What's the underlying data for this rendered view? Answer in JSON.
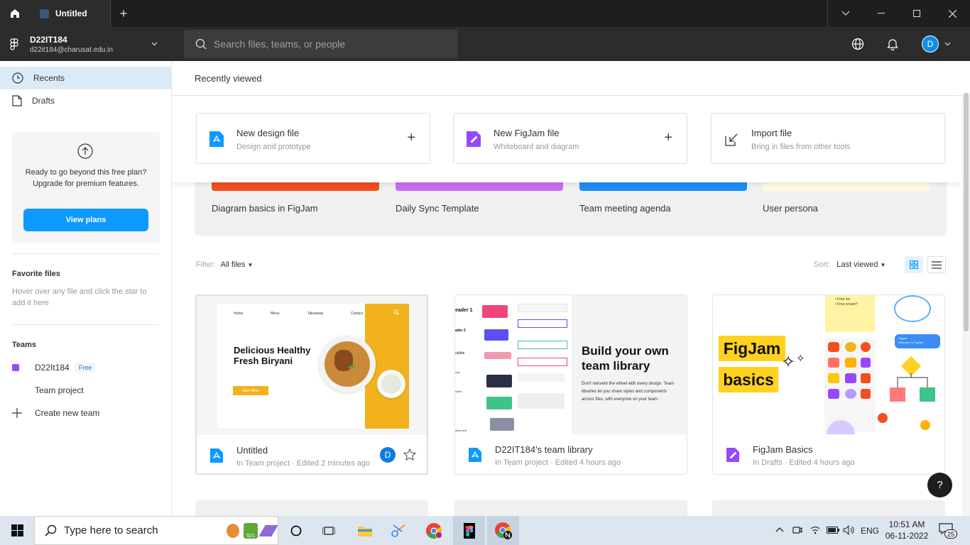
{
  "window": {
    "tab_title": "Untitled",
    "new_tab": "+"
  },
  "header": {
    "team_name": "D22IT184",
    "team_email": "d22it184@charusat.edu.in",
    "search_placeholder": "Search files, teams, or people",
    "avatar_letter": "D"
  },
  "sidebar": {
    "recents": "Recents",
    "drafts": "Drafts",
    "upgrade_text": "Ready to go beyond this free plan? Upgrade for premium features.",
    "view_plans": "View plans",
    "favorite_heading": "Favorite files",
    "favorite_hint": "Hover over any file and click the star to add it here",
    "teams_heading": "Teams",
    "team_item": "D22It184",
    "free_badge": "Free",
    "team_project": "Team project",
    "create_team": "Create new team"
  },
  "main": {
    "title": "Recently viewed",
    "create": [
      {
        "title": "New design file",
        "subtitle": "Design and prototype"
      },
      {
        "title": "New FigJam file",
        "subtitle": "Whiteboard and diagram"
      },
      {
        "title": "Import file",
        "subtitle": "Bring in files from other tools"
      }
    ],
    "templates": [
      {
        "label": "Diagram basics in FigJam",
        "color": "#f24e1e"
      },
      {
        "label": "Daily Sync Template",
        "color": "#c86ef3"
      },
      {
        "label": "Team meeting agenda",
        "color": "#1d8cf8"
      },
      {
        "label": "User persona",
        "color": "#fff1c2"
      }
    ],
    "filter_label": "Filter:",
    "filter_value": "All files",
    "sort_label": "Sort:",
    "sort_value": "Last viewed",
    "files": [
      {
        "name": "Untitled",
        "meta": "In Team project · Edited 2 minutes ago",
        "avatar": "D"
      },
      {
        "name": "D22IT184's team library",
        "meta": "In Team project · Edited 4 hours ago"
      },
      {
        "name": "FigJam Basics",
        "meta": "In Drafts · Edited 4 hours ago"
      }
    ],
    "thumb1": {
      "nav": [
        "Home",
        "Menu",
        "Takeaway",
        "Contact"
      ],
      "headline": "Delicious Healthy Fresh Biryani",
      "button": "View Menu"
    },
    "thumb2": {
      "headline": "Build your own team library",
      "body": "Don't reinvent the wheel with every design. Team libraries let you share styles and components across files, with everyone on your team.",
      "side_labels": [
        "eader 1",
        "ader 2",
        "ubtitle",
        "ody",
        "ooter",
        "utton text"
      ]
    },
    "thumb3": {
      "word1": "FigJam",
      "word2": "basics",
      "note1": "• Free ice",
      "note2": "• Free cream?",
      "bubble1": "Figjam",
      "bubble2": "Welcome to FigJam"
    },
    "help": "?"
  },
  "taskbar": {
    "search_text": "Type here to search",
    "lang": "ENG",
    "time": "10:51 AM",
    "date": "06-11-2022",
    "notif_count": "25",
    "badge_521": "521"
  }
}
